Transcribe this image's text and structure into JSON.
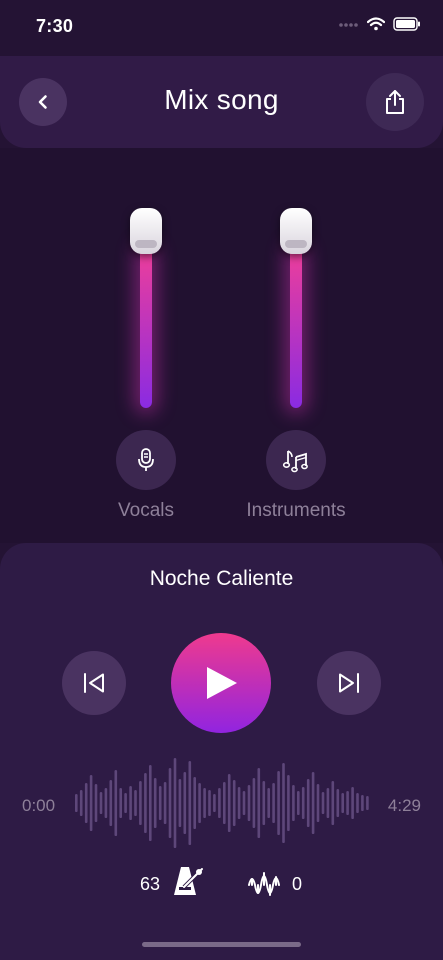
{
  "status": {
    "time": "7:30"
  },
  "header": {
    "title": "Mix song",
    "back_icon": "chevron-left-icon",
    "share_icon": "share-icon"
  },
  "channels": [
    {
      "label": "Vocals",
      "icon": "microphone-icon",
      "level": 1.0
    },
    {
      "label": "Instruments",
      "icon": "music-notes-icon",
      "level": 1.0
    }
  ],
  "player": {
    "song_title": "Noche Caliente",
    "current_time": "0:00",
    "total_time": "4:29",
    "bpm": "63",
    "gain": "0"
  },
  "colors": {
    "background": "#241334",
    "accent_pink": "#ef3a8e",
    "accent_purple": "#9124e0",
    "knob": "#ffffff"
  }
}
